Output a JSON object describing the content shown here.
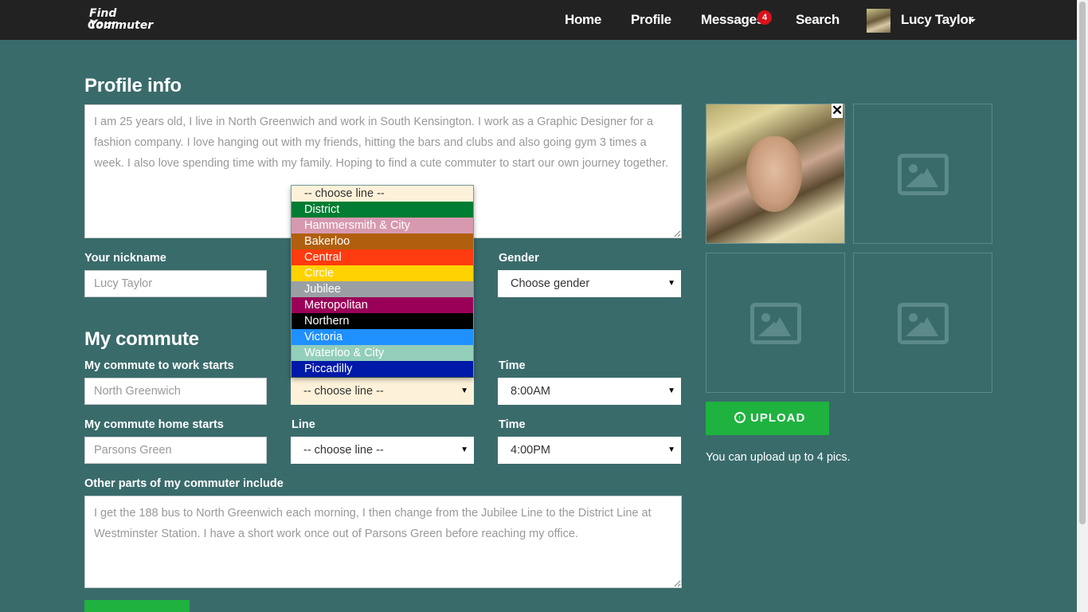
{
  "nav": {
    "logo_line1": "Find Your",
    "logo_line2": "Commuter",
    "home": "Home",
    "profile": "Profile",
    "messages": "Messages",
    "messages_badge": "4",
    "search": "Search",
    "user_name": "Lucy Taylor"
  },
  "profile": {
    "heading": "Profile info",
    "bio": "I am 25 years old, I live in North Greenwich and work in South Kensington. I work as a Graphic Designer for a fashion company. I love hanging out with my friends, hitting the bars and clubs and also going gym 3 times a week. I also love spending time with my family. Hoping to find a cute commuter to start our own journey together.",
    "nickname_label": "Your nickname",
    "nickname_value": "Lucy Taylor",
    "gender_label": "Gender",
    "gender_value": "Choose gender"
  },
  "commute": {
    "heading": "My commute",
    "work_start_label": "My commute to work starts",
    "work_start_value": "North Greenwich",
    "work_line_value": "-- choose line --",
    "work_time_label": "Time",
    "work_time_value": "8:00AM",
    "home_start_label": "My commute home starts",
    "home_start_value": "Parsons Green",
    "home_line_label": "Line",
    "home_line_value": "-- choose line --",
    "home_time_label": "Time",
    "home_time_value": "4:00PM",
    "other_label": "Other parts of my commuter include",
    "other_value": "I get the 188 bus to North Greenwich each morning, I then change from the Jubilee Line to the District Line at Westminster Station. I have a short work once out of Parsons Green before reaching my office."
  },
  "line_dropdown": {
    "options": [
      {
        "label": "-- choose line --",
        "color": "#fdf2d9",
        "text_color": "#333333"
      },
      {
        "label": "District",
        "color": "#007d32",
        "text_color": "#ffffff"
      },
      {
        "label": "Hammersmith & City",
        "color": "#d799af",
        "text_color": "#ffffff"
      },
      {
        "label": "Bakerloo",
        "color": "#b05f0f",
        "text_color": "#ffffff"
      },
      {
        "label": "Central",
        "color": "#ff3b0f",
        "text_color": "#ffffff"
      },
      {
        "label": "Circle",
        "color": "#ffd200",
        "text_color": "#ffffff"
      },
      {
        "label": "Jubilee",
        "color": "#9aa0a4",
        "text_color": "#ffffff"
      },
      {
        "label": "Metropolitan",
        "color": "#9b0058",
        "text_color": "#ffffff"
      },
      {
        "label": "Northern",
        "color": "#000000",
        "text_color": "#ffffff"
      },
      {
        "label": "Victoria",
        "color": "#1e90ff",
        "text_color": "#ffffff"
      },
      {
        "label": "Waterloo & City",
        "color": "#93ceba",
        "text_color": "#ffffff"
      },
      {
        "label": "Piccadilly",
        "color": "#0019a8",
        "text_color": "#ffffff"
      }
    ]
  },
  "photos": {
    "close_label": "✕",
    "upload_label": "UPLOAD",
    "note": "You can upload up to 4 pics."
  },
  "colors": {
    "background": "#3a6b6b",
    "navbar": "#222222",
    "accent_green": "#1fb23f"
  }
}
